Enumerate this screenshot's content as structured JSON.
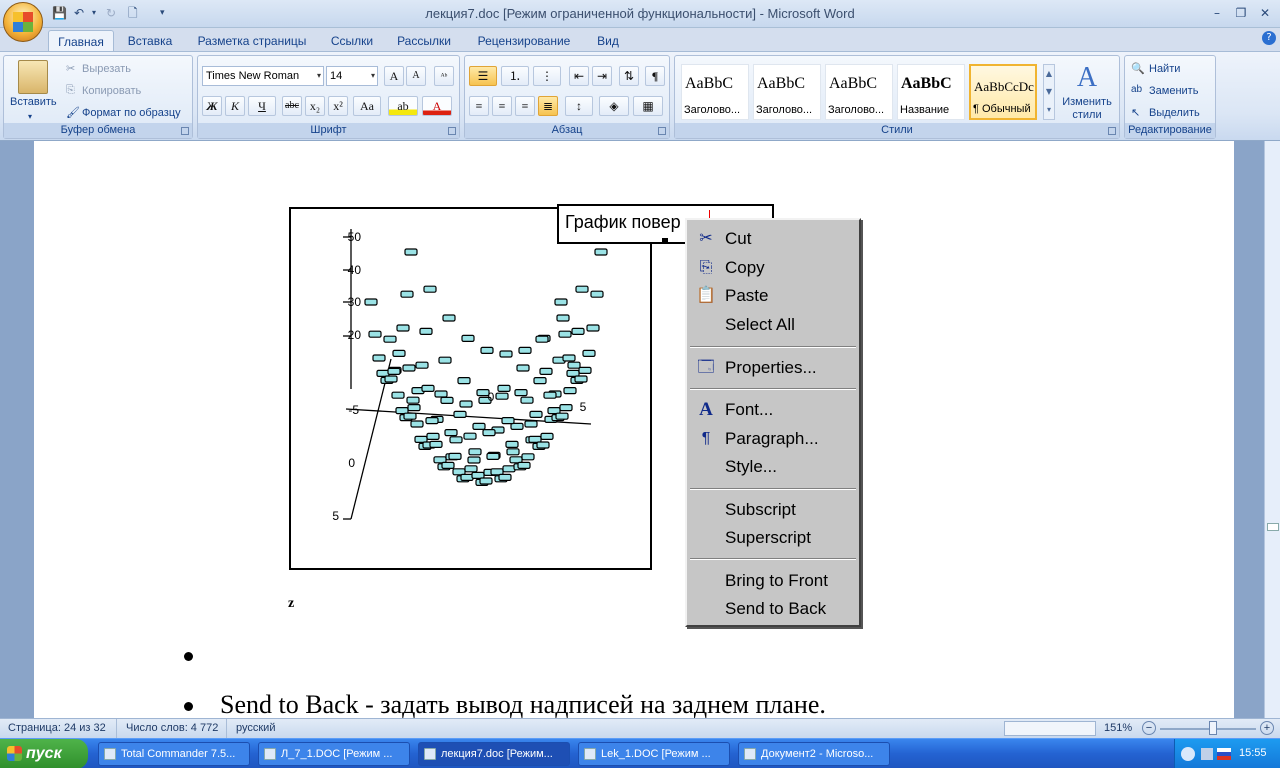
{
  "window": {
    "title": "лекция7.doc [Режим ограниченной функциональности] - Microsoft Word",
    "controls": {
      "minimize": "–",
      "restore": "❐",
      "close": "✕"
    }
  },
  "ribbon_tabs": [
    {
      "label": "Главная",
      "active": true
    },
    {
      "label": "Вставка"
    },
    {
      "label": "Разметка страницы"
    },
    {
      "label": "Ссылки"
    },
    {
      "label": "Рассылки"
    },
    {
      "label": "Рецензирование"
    },
    {
      "label": "Вид"
    }
  ],
  "clipboard": {
    "group_label": "Буфер обмена",
    "paste": "Вставить",
    "cut": "Вырезать",
    "copy": "Копировать",
    "format_painter": "Формат по образцу"
  },
  "font": {
    "group_label": "Шрифт",
    "font_name": "Times New Roman",
    "font_size": "14",
    "grow": "A",
    "shrink": "A",
    "bold": "Ж",
    "italic": "К",
    "underline": "Ч",
    "strike": "abc",
    "subscript": "x₂",
    "superscript": "x²",
    "case": "Aa",
    "highlight": "ab",
    "color": "A"
  },
  "paragraph": {
    "group_label": "Абзац",
    "pilcrow": "¶"
  },
  "styles": {
    "group_label": "Стили",
    "items": [
      {
        "sample": "AaBbC",
        "name": "Заголово..."
      },
      {
        "sample": "AaBbC",
        "name": "Заголово..."
      },
      {
        "sample": "AaBbC",
        "name": "Заголово..."
      },
      {
        "sample": "AaBbC",
        "name": "Название"
      },
      {
        "sample": "AaBbCcDc",
        "name": "¶ Обычный",
        "selected": true
      }
    ],
    "change_styles": "Изменить стили"
  },
  "editing": {
    "group_label": "Редактирование",
    "find": "Найти",
    "replace": "Заменить",
    "select": "Выделить"
  },
  "document": {
    "caption_text": "График повер",
    "z_label": "z",
    "bullet_text": "Send to Back - задать вывод надписей на заднем плане.",
    "plot_axis_labels": [
      "50",
      "40",
      "30",
      "20",
      "-5",
      "0",
      "5",
      "0",
      "5"
    ]
  },
  "context_menu": {
    "items": [
      {
        "label": "Cut",
        "icon": "scissors-icon"
      },
      {
        "label": "Copy",
        "icon": "copy-icon"
      },
      {
        "label": "Paste",
        "icon": "paste-icon"
      },
      {
        "label": "Select All",
        "icon": ""
      },
      {
        "label": "Properties...",
        "icon": "properties-icon"
      },
      {
        "label": "Font...",
        "icon": "font-icon"
      },
      {
        "label": "Paragraph...",
        "icon": "paragraph-icon"
      },
      {
        "label": "Style...",
        "icon": ""
      },
      {
        "label": "Subscript",
        "icon": ""
      },
      {
        "label": "Superscript",
        "icon": ""
      },
      {
        "label": "Bring to Front",
        "icon": ""
      },
      {
        "label": "Send to Back",
        "icon": ""
      }
    ]
  },
  "status_bar": {
    "page": "Страница: 24 из 32",
    "words": "Число слов: 4 772",
    "language": "русский",
    "zoom": "151%"
  },
  "taskbar": {
    "start": "пуск",
    "tasks": [
      {
        "label": "Total Commander 7.5..."
      },
      {
        "label": "Л_7_1.DOC [Режим ..."
      },
      {
        "label": "лекция7.doc [Режим...",
        "active": true
      },
      {
        "label": "Lek_1.DOC [Режим ..."
      },
      {
        "label": "Документ2 - Microso..."
      }
    ],
    "clock": "15:55"
  },
  "colors": {
    "accent": "#15428b",
    "surface_cyan": "#9be3e6",
    "taskbar": "#2463d2"
  }
}
